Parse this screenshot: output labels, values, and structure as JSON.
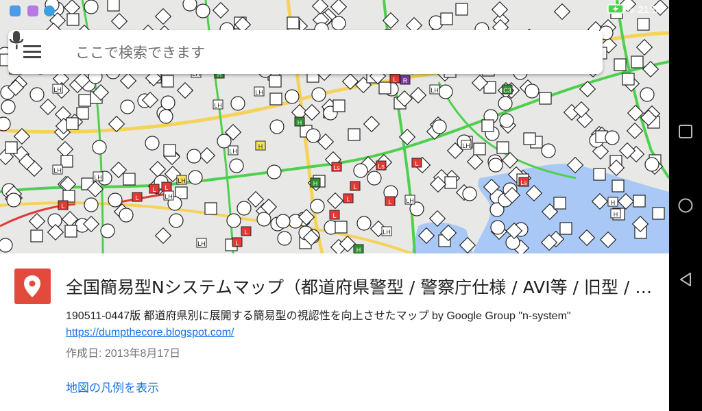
{
  "status_bar": {
    "battery": "100%",
    "time": "21:53",
    "apps": [
      {
        "icon": "maps-notification-icon",
        "color": "#4a9be8"
      },
      {
        "icon": "gallery-notification-icon",
        "color": "#b57be0"
      },
      {
        "icon": "download-notification-icon",
        "color": "#3aa0e0"
      }
    ],
    "wifi_icon": "wifi-icon",
    "battery_icon": "battery-charging-icon"
  },
  "search": {
    "placeholder": "ここで検索できます",
    "menu_icon": "hamburger-menu-icon",
    "mic_icon": "microphone-icon"
  },
  "map_card": {
    "title": "全国簡易型Nシステムマップ（都道府県警型 / 警察庁仕様 / AVI等 / 旧型 / 可搬式 / 検問）",
    "description": "190511-0447版 都道府県別に展開する簡易型の視認性を向上させたマップ by Google Group \"n-system\"",
    "link": "https://dumpthecore.blogspot.com/",
    "created": "作成日: 2013年8月17日",
    "legend_link": "地図の凡例を表示",
    "icon": "map-pin-icon",
    "accent": "#e24b3b"
  },
  "map_labels": {
    "lh": "LH",
    "h": "H",
    "l": "L",
    "ls": "Ls",
    "r": "R",
    "c3": "C3"
  },
  "nav_bar": {
    "recents_icon": "recent-apps-icon",
    "home_icon": "home-icon",
    "back_icon": "back-icon"
  },
  "colors": {
    "link": "#1a73e8",
    "water": "#a9c8f5",
    "traffic_green": "#4ed04e",
    "traffic_red": "#e53935",
    "road_yellow": "#f5d25a"
  }
}
